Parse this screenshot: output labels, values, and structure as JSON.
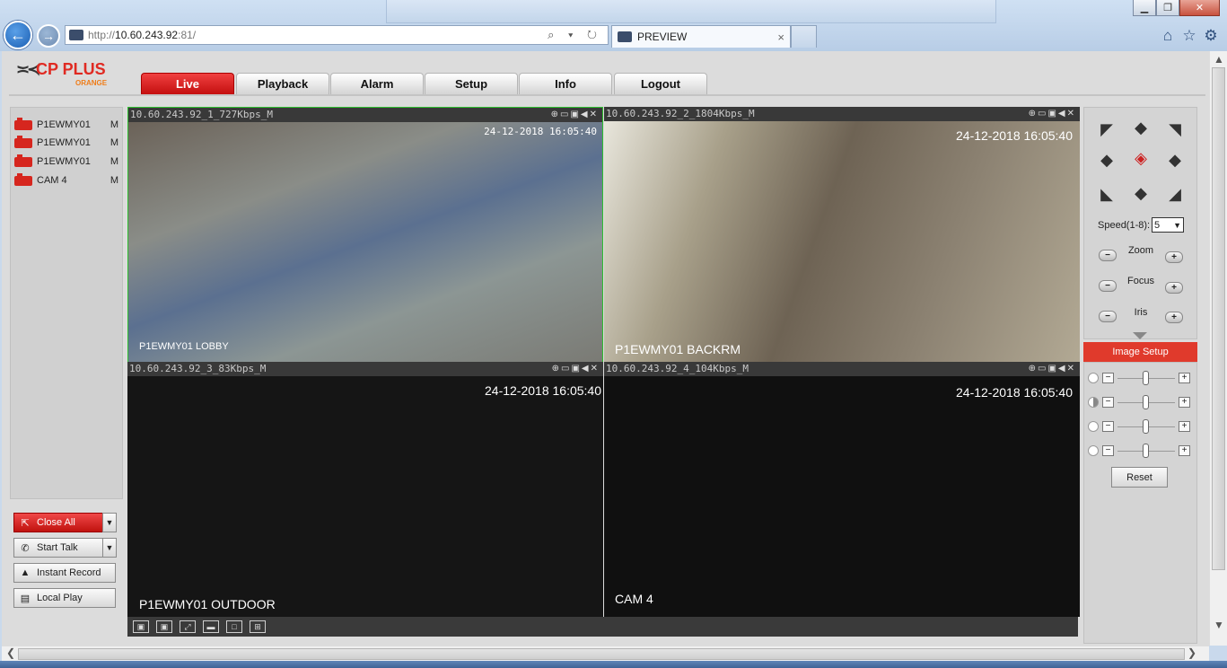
{
  "browser": {
    "address_base": "http://",
    "address_host": "10.60.243.92",
    "address_port": ":81/",
    "tab_title": "PREVIEW",
    "address_tools": "⌕ ▾ ↻",
    "tab_close": "×",
    "window_min": "▁",
    "window_max": "❐",
    "window_close": "✕"
  },
  "app": {
    "logo_text": "CP PLUS",
    "logo_sub": "ORANGE",
    "nav_tabs": [
      {
        "label": "Live",
        "active": true
      },
      {
        "label": "Playback"
      },
      {
        "label": "Alarm"
      },
      {
        "label": "Setup"
      },
      {
        "label": "Info"
      },
      {
        "label": "Logout"
      }
    ]
  },
  "camera_list": [
    {
      "name": "P1EWMY01",
      "mode": "M"
    },
    {
      "name": "P1EWMY01",
      "mode": "M"
    },
    {
      "name": "P1EWMY01",
      "mode": "M"
    },
    {
      "name": "CAM 4",
      "mode": "M"
    }
  ],
  "controls": {
    "close_all": "Close All",
    "start_talk": "Start Talk",
    "instant_record": "Instant Record",
    "local_play": "Local Play"
  },
  "cells": [
    {
      "header": "10.60.243.92_1_727Kbps_M",
      "timestamp": "24-12-2018 16:05:40",
      "label": "P1EWMY01 LOBBY"
    },
    {
      "header": "10.60.243.92_2_1804Kbps_M",
      "timestamp": "24-12-2018 16:05:40",
      "label": "P1EWMY01 BACKRM"
    },
    {
      "header": "10.60.243.92_3_83Kbps_M",
      "timestamp": "24-12-2018 16:05:40",
      "label": "P1EWMY01 OUTDOOR"
    },
    {
      "header": "10.60.243.92_4_104Kbps_M",
      "timestamp": "24-12-2018 16:05:40",
      "label": "CAM 4"
    }
  ],
  "ptz": {
    "speed_label": "Speed(1-8):",
    "speed_value": "5",
    "zoom": "Zoom",
    "focus": "Focus",
    "iris": "Iris"
  },
  "image_setup": {
    "title": "Image Setup",
    "reset": "Reset",
    "slider_count": 4
  },
  "icons": {
    "cell_toolbar": "⊕▭▣◀✕",
    "minus": "−",
    "plus": "+",
    "dropdown": "▼"
  },
  "colors": {
    "accent_red": "#e03a2c",
    "active_cell_border": "#2fbf2f"
  }
}
